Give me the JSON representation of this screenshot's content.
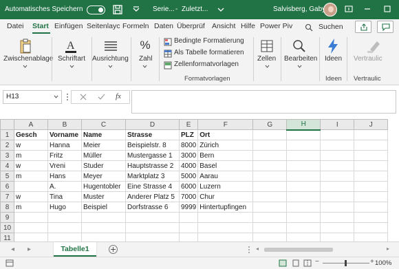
{
  "titlebar": {
    "autosave_label": "Automatisches Speichern",
    "doc_name": "Serie...",
    "saved_status": "Zuletzt...",
    "user_name": "Salvisberg, Gaby"
  },
  "ribbon_tabs": [
    "Datei",
    "Start",
    "Einfügen",
    "Seitenlayc",
    "Formeln",
    "Daten",
    "Überprüf",
    "Ansicht",
    "Hilfe",
    "Power Piv"
  ],
  "active_tab": "Start",
  "search_label": "Suchen",
  "ribbon": {
    "zwischenablage": "Zwischenablage",
    "schriftart": "Schriftart",
    "ausrichtung": "Ausrichtung",
    "zahl": "Zahl",
    "zahl_icon": "%",
    "bedingte_formatierung": "Bedingte Formatierung",
    "als_tabelle": "Als Tabelle formatieren",
    "zellenformatvorlagen": "Zellenformatvorlagen",
    "formatvorlagen_group": "Formatvorlagen",
    "zellen": "Zellen",
    "bearbeiten": "Bearbeiten",
    "ideen_button": "Ideen",
    "ideen_group": "Ideen",
    "vertraulich": "Vertraulic",
    "vertraulich_group": "Vertraulic"
  },
  "formula_bar": {
    "name_box": "H13",
    "fx_label": "fx",
    "formula_value": ""
  },
  "grid": {
    "columns": [
      "A",
      "B",
      "C",
      "D",
      "E",
      "F",
      "G",
      "H",
      "I",
      "J"
    ],
    "selected_column": "H",
    "row_numbers": [
      "1",
      "2",
      "3",
      "4",
      "5",
      "6",
      "7",
      "8",
      "9",
      "10",
      "11"
    ],
    "rows": [
      [
        "Gesch",
        "Vorname",
        "Name",
        "Strasse",
        "PLZ",
        "Ort",
        "",
        "",
        "",
        ""
      ],
      [
        "w",
        "Hanna",
        "Meier",
        "Beispielstr. 8",
        "8000",
        "Zürich",
        "",
        "",
        "",
        ""
      ],
      [
        "m",
        "Fritz",
        "Müller",
        "Mustergasse 1",
        "3000",
        "Bern",
        "",
        "",
        "",
        ""
      ],
      [
        "w",
        "Vreni",
        "Studer",
        "Hauptstrasse 2",
        "4000",
        "Basel",
        "",
        "",
        "",
        ""
      ],
      [
        "m",
        "Hans",
        "Meyer",
        "Marktplatz 3",
        "5000",
        "Aarau",
        "",
        "",
        "",
        ""
      ],
      [
        "",
        "A.",
        "Hugentobler",
        "Eine Strasse 4",
        "6000",
        "Luzern",
        "",
        "",
        "",
        ""
      ],
      [
        "w",
        "Tina",
        "Muster",
        "Anderer Platz 5",
        "7000",
        "Chur",
        "",
        "",
        "",
        ""
      ],
      [
        "m",
        "Hugo",
        "Beispiel",
        "Dorfstrasse 6",
        "9999",
        "Hintertupfingen",
        "",
        "",
        "",
        ""
      ],
      [
        "",
        "",
        "",
        "",
        "",
        "",
        "",
        "",
        "",
        ""
      ],
      [
        "",
        "",
        "",
        "",
        "",
        "",
        "",
        "",
        "",
        ""
      ],
      [
        "",
        "",
        "",
        "",
        "",
        "",
        "",
        "",
        "",
        ""
      ]
    ]
  },
  "sheets": {
    "active_sheet": "Tabelle1"
  },
  "status": {
    "zoom": "100%"
  },
  "colors": {
    "excel_green": "#217346",
    "ribbon_bg": "#f3f3f3"
  }
}
